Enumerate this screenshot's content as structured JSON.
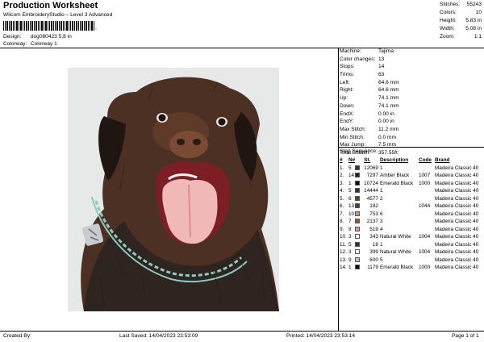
{
  "header": {
    "title": "Production Worksheet",
    "subtitle": "Wilcom EmbroideryStudio – Level 3 Advanced",
    "barcode_suffix": ",",
    "design_label": "Design:",
    "design_value": "dog080423 5,8 in",
    "colorway_label": "Colorway:",
    "colorway_value": "Colorway 1"
  },
  "top_stats": [
    {
      "label": "Stitches:",
      "value": "55243"
    },
    {
      "label": "Colors:",
      "value": "10"
    },
    {
      "label": "Height:",
      "value": "5.83 in"
    },
    {
      "label": "Width:",
      "value": "5.08 in"
    },
    {
      "label": "Zoom:",
      "value": "1:1"
    }
  ],
  "machine_info": [
    {
      "label": "Machine:",
      "value": "Tajima"
    },
    {
      "label": "Color changes:",
      "value": "13"
    },
    {
      "label": "Stops:",
      "value": "14"
    },
    {
      "label": "Trims:",
      "value": "63"
    },
    {
      "label": "Left:",
      "value": "64.6 mm"
    },
    {
      "label": "Right:",
      "value": "64.6 mm"
    },
    {
      "label": "Up:",
      "value": "74.1 mm"
    },
    {
      "label": "Down:",
      "value": "74.1 mm"
    },
    {
      "label": "EndX:",
      "value": "0.00 in"
    },
    {
      "label": "EndY:",
      "value": "0.00 in"
    },
    {
      "label": "Max Stitch:",
      "value": "11.2 mm"
    },
    {
      "label": "Min Stitch:",
      "value": "0.0 mm"
    },
    {
      "label": "Max Jump:",
      "value": "7.5 mm"
    },
    {
      "label": "Total Bobbin:",
      "value": "357.55ft"
    }
  ],
  "stop_sequence": {
    "title": "Stop Sequence:",
    "headers": [
      "#",
      "N#",
      "",
      "St.",
      "Description",
      "Code",
      "Brand"
    ],
    "rows": [
      {
        "idx": "1.",
        "n": "5",
        "color": "#4a2a1c",
        "st": "12069",
        "desc": "1",
        "code": "",
        "brand": "Madeira Classic 40"
      },
      {
        "idx": "2.",
        "n": "14",
        "color": "#2b1d17",
        "st": "7297",
        "desc": "Amber Black",
        "code": "1007",
        "brand": "Madeira Classic 40"
      },
      {
        "idx": "3.",
        "n": "1",
        "color": "#0a0a0a",
        "st": "10724",
        "desc": "Emerald Black",
        "code": "1000",
        "brand": "Madeira Classic 40"
      },
      {
        "idx": "4.",
        "n": "5",
        "color": "#4a2a1c",
        "st": "14444",
        "desc": "1",
        "code": "",
        "brand": "Madeira Classic 40"
      },
      {
        "idx": "5.",
        "n": "6",
        "color": "#6b3e2b",
        "st": "4577",
        "desc": "2",
        "code": "",
        "brand": "Madeira Classic 40"
      },
      {
        "idx": "6.",
        "n": "13",
        "color": "#3a3f46",
        "st": "182",
        "desc": "",
        "code": "1044",
        "brand": "Madeira Classic 40"
      },
      {
        "idx": "7.",
        "n": "10",
        "color": "#d98a86",
        "st": "753",
        "desc": "6",
        "code": "",
        "brand": "Madeira Classic 40"
      },
      {
        "idx": "8.",
        "n": "7",
        "color": "#8c5a43",
        "st": "2137",
        "desc": "3",
        "code": "",
        "brand": "Madeira Classic 40"
      },
      {
        "idx": "9.",
        "n": "8",
        "color": "#e58f95",
        "st": "519",
        "desc": "4",
        "code": "",
        "brand": "Madeira Classic 40"
      },
      {
        "idx": "10.",
        "n": "3",
        "color": "#f4f4f4",
        "st": "343",
        "desc": "Natural White",
        "code": "1004",
        "brand": "Madeira Classic 40"
      },
      {
        "idx": "11.",
        "n": "5",
        "color": "#4a2a1c",
        "st": "18",
        "desc": "1",
        "code": "",
        "brand": "Madeira Classic 40"
      },
      {
        "idx": "12.",
        "n": "3",
        "color": "#f4f4f4",
        "st": "399",
        "desc": "Natural White",
        "code": "1004",
        "brand": "Madeira Classic 40"
      },
      {
        "idx": "13.",
        "n": "9",
        "color": "#b9bcc0",
        "st": "600",
        "desc": "5",
        "code": "",
        "brand": "Madeira Classic 40"
      },
      {
        "idx": "14.",
        "n": "1",
        "color": "#0a0a0a",
        "st": "1179",
        "desc": "Emerald Black",
        "code": "1000",
        "brand": "Madeira Classic 40"
      }
    ]
  },
  "footer": {
    "created_by": "Created By:",
    "last_saved": "Last Saved:  14/04/2023 23:53:09",
    "printed": "Printed:  14/04/2023 23:53:14",
    "page": "Page 1 of 1"
  },
  "image": {
    "description_icon": "embroidery-dog-image",
    "background_color": "#e7e8e8",
    "fur_color": "#4b3023",
    "tongue_color": "#f0b8b6",
    "collar_color": "#8fc9bf"
  }
}
